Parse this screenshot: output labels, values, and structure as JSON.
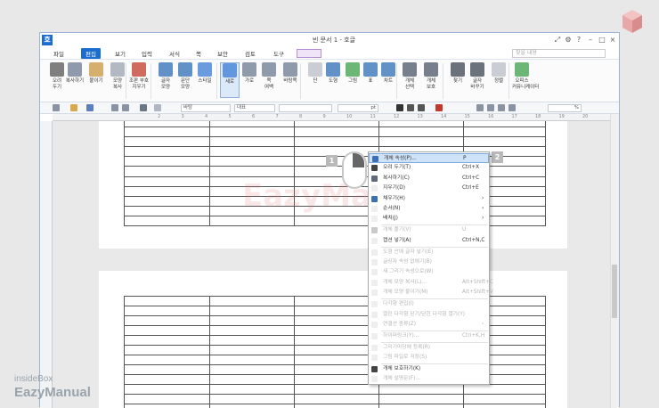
{
  "app": {
    "title": "빈 문서 1 - 호글",
    "icon_glyph": "호",
    "window_controls": [
      "⤢",
      "⚙",
      "?",
      "–",
      "□",
      "×"
    ]
  },
  "menubar": {
    "items": [
      "파일",
      "편집",
      "보기",
      "입력",
      "서식",
      "쪽",
      "보안",
      "검토",
      "도구"
    ],
    "active": "편집",
    "search_placeholder": "찾을 내용"
  },
  "ribbon": {
    "buttons": [
      {
        "label": "오려\n두기",
        "icon": "scissors-icon"
      },
      {
        "label": "복사하기",
        "icon": "copy-icon"
      },
      {
        "label": "붙이기",
        "icon": "paste-icon"
      },
      {
        "label": "모양\n복사",
        "icon": "format-painter-icon"
      },
      {
        "label": "조판 부호\n지우기",
        "icon": "clear-marks-icon"
      },
      {
        "label": "글자\n모양",
        "icon": "char-shape-icon"
      },
      {
        "label": "문단\n모양",
        "icon": "para-shape-icon"
      },
      {
        "label": "스타일",
        "icon": "style-icon"
      },
      {
        "label": "세로",
        "icon": "portrait-icon"
      },
      {
        "label": "가로",
        "icon": "landscape-icon"
      },
      {
        "label": "쪽\n여백",
        "icon": "margin-icon"
      },
      {
        "label": "바탕쪽",
        "icon": "master-page-icon"
      },
      {
        "label": "단",
        "icon": "columns-icon"
      },
      {
        "label": "도형",
        "icon": "shape-icon"
      },
      {
        "label": "그림",
        "icon": "picture-icon"
      },
      {
        "label": "표",
        "icon": "table-icon"
      },
      {
        "label": "차트",
        "icon": "chart-icon"
      },
      {
        "label": "개체\n선택",
        "icon": "select-object-icon"
      },
      {
        "label": "개체\n보호",
        "icon": "protect-object-icon"
      },
      {
        "label": "찾기",
        "icon": "binoculars-icon"
      },
      {
        "label": "글자\n바꾸기",
        "icon": "replace-icon"
      },
      {
        "label": "정렬",
        "icon": "sort-icon"
      },
      {
        "label": "오피스\n커뮤니케이터",
        "icon": "communicator-icon"
      }
    ]
  },
  "toolbar": {
    "style": "바탕",
    "font": "대표",
    "font_size_unit": "pt",
    "zoom_unit": "%"
  },
  "ruler": {
    "marks": [
      "2",
      "3",
      "4",
      "5",
      "6",
      "7",
      "8",
      "9",
      "10",
      "11",
      "12",
      "13",
      "14",
      "15",
      "16",
      "17",
      "18",
      "19",
      "20"
    ]
  },
  "context_menu": {
    "items": [
      {
        "label": "개체 속성(P)...",
        "shortcut": "P",
        "state": "highlighted",
        "icon": "properties-icon"
      },
      {
        "label": "오려 두기(T)",
        "shortcut": "Ctrl+X",
        "state": "normal",
        "icon": "scissors-icon"
      },
      {
        "label": "복사하기(C)",
        "shortcut": "Ctrl+C",
        "state": "normal",
        "icon": "copy-icon"
      },
      {
        "label": "지우기(D)",
        "shortcut": "Ctrl+E",
        "state": "normal",
        "icon": ""
      },
      {
        "label": "채우기(H)",
        "shortcut": "",
        "state": "submenu",
        "icon": "fill-icon"
      },
      {
        "label": "순서(N)",
        "shortcut": "",
        "state": "submenu",
        "icon": ""
      },
      {
        "label": "배치(J)",
        "shortcut": "",
        "state": "submenu",
        "icon": ""
      },
      {
        "label": "개체 풀기(V)",
        "shortcut": "U",
        "state": "disabled",
        "icon": "ungroup-icon"
      },
      {
        "label": "캡션 넣기(A)",
        "shortcut": "Ctrl+N,C",
        "state": "normal",
        "icon": ""
      },
      {
        "label": "도형 안에 글자 넣기(E)",
        "shortcut": "",
        "state": "disabled",
        "icon": ""
      },
      {
        "label": "글상자 속성 없애기(B)",
        "shortcut": "",
        "state": "disabled",
        "icon": ""
      },
      {
        "label": "새 그리기 속성으로(W)",
        "shortcut": "",
        "state": "disabled",
        "icon": ""
      },
      {
        "label": "개체 모양 복사(L)...",
        "shortcut": "Alt+Shift+C",
        "state": "disabled",
        "icon": ""
      },
      {
        "label": "개체 모양 붙이기(M)",
        "shortcut": "Alt+Shift+V",
        "state": "disabled",
        "icon": ""
      },
      {
        "label": "다각형 편집(I)",
        "shortcut": "",
        "state": "disabled",
        "icon": ""
      },
      {
        "label": "열린 다각형 닫기/닫힌 다각형 열기(Y)",
        "shortcut": "",
        "state": "disabled",
        "icon": ""
      },
      {
        "label": "연결선 종류(Z)",
        "shortcut": "",
        "state": "disabled-submenu",
        "icon": ""
      },
      {
        "label": "하이퍼링크(Y)...",
        "shortcut": "Ctrl+K,H",
        "state": "disabled",
        "icon": ""
      },
      {
        "label": "그리기마당에 등록(R)",
        "shortcut": "",
        "state": "disabled",
        "icon": ""
      },
      {
        "label": "그림 파일로 저장(S)",
        "shortcut": "",
        "state": "disabled",
        "icon": ""
      },
      {
        "label": "개체 보호하기(K)",
        "shortcut": "",
        "state": "normal",
        "icon": "protect-icon"
      },
      {
        "label": "개체 설명문(F)...",
        "shortcut": "",
        "state": "disabled",
        "icon": ""
      }
    ]
  },
  "overlay": {
    "badge_left": "1",
    "badge_right": "2",
    "watermark": "EazyManual",
    "brand_line1": "insideBox",
    "brand_line2": "EazyManual"
  },
  "colors": {
    "accent": "#1b6ecf",
    "highlight": "#cfe3f8"
  }
}
